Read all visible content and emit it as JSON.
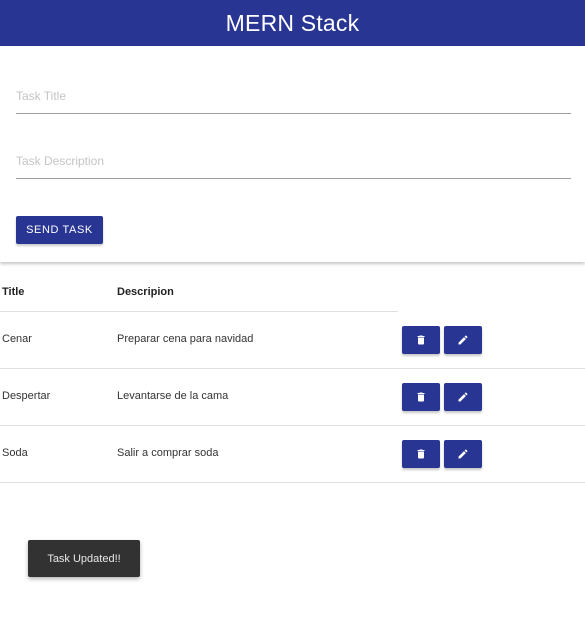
{
  "navbar": {
    "brand": "MERN Stack"
  },
  "form": {
    "title_placeholder": "Task Title",
    "title_value": "",
    "description_placeholder": "Task Description",
    "description_value": "",
    "submit_label": "SEND TASK"
  },
  "table": {
    "headers": {
      "title": "Title",
      "description": "Descripion"
    },
    "rows": [
      {
        "title": "Cenar",
        "description": "Preparar cena para navidad"
      },
      {
        "title": "Despertar",
        "description": "Levantarse de la cama"
      },
      {
        "title": "Soda",
        "description": "Salir a comprar soda"
      }
    ],
    "row_actions": {
      "delete_icon": "trash-icon",
      "edit_icon": "pencil-icon"
    }
  },
  "toast": {
    "message": "Task Updated!!"
  },
  "colors": {
    "primary": "#283593",
    "toast_bg": "#323232",
    "divider": "#e0e0e0"
  }
}
